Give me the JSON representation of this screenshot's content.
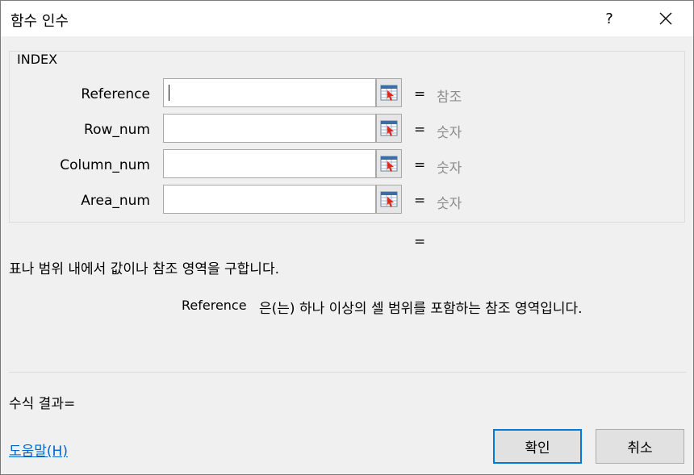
{
  "window": {
    "title": "함수 인수",
    "help_label": "?"
  },
  "function": {
    "name": "INDEX"
  },
  "arguments": [
    {
      "label": "Reference",
      "value": "",
      "type": "참조"
    },
    {
      "label": "Row_num",
      "value": "",
      "type": "숫자"
    },
    {
      "label": "Column_num",
      "value": "",
      "type": "숫자"
    },
    {
      "label": "Area_num",
      "value": "",
      "type": "숫자"
    }
  ],
  "equals_sign": "=",
  "result_equals": "=",
  "description": "표나 범위 내에서 값이나 참조 영역을 구합니다.",
  "argument_help": {
    "name": "Reference",
    "text": "은(는) 하나 이상의 셀 범위를 포함하는 참조 영역입니다."
  },
  "formula_result": "수식 결과=",
  "help_link": "도움말(H)",
  "buttons": {
    "ok": "확인",
    "cancel": "취소"
  },
  "icons": {
    "ref": "range-selector-icon",
    "close": "close-icon",
    "help": "help-icon"
  }
}
